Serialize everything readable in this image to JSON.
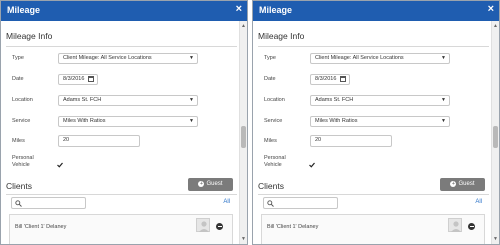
{
  "dialog": {
    "title": "Mileage",
    "close_glyph": "×",
    "section_title": "Mileage Info",
    "fields": {
      "type": {
        "label": "Type",
        "value": "Client Mileage: All Service Locations"
      },
      "date": {
        "label": "Date",
        "value": "8/3/2016"
      },
      "location": {
        "label": "Location",
        "value": "Adams St. FCH"
      },
      "service": {
        "label": "Service",
        "value": "Miles With Ratios"
      },
      "miles": {
        "label": "Miles",
        "value": "20"
      },
      "personal_vehicle": {
        "label_line1": "Personal",
        "label_line2": "Vehicle",
        "checked": true
      }
    },
    "clients": {
      "title": "Clients",
      "guest_button": "Guest",
      "search_placeholder": "",
      "all_link": "All",
      "rows": [
        {
          "name": "Bill 'Client 1' Delaney"
        }
      ]
    }
  },
  "icons": {
    "close": "close-icon",
    "calendar": "calendar-icon",
    "dropdown": "chevron-down-icon",
    "search": "search-icon",
    "add": "plus-icon",
    "remove": "minus-circle-icon",
    "avatar": "person-placeholder-icon"
  },
  "colors": {
    "titlebar": "#1f5db0",
    "guest_button": "#7b7b7b",
    "link": "#2a72c7"
  }
}
